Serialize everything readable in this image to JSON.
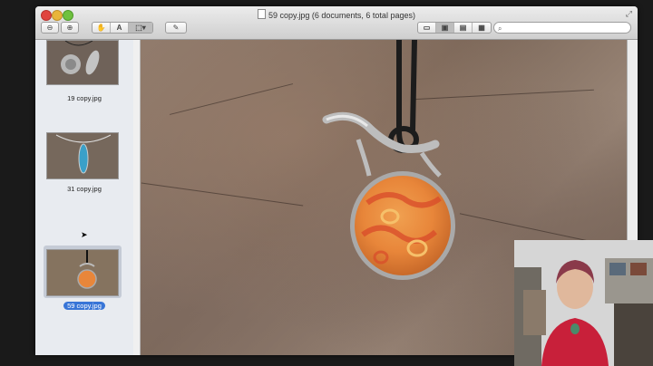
{
  "window": {
    "title": "59 copy.jpg (6 documents, 6 total pages)"
  },
  "toolbar": {
    "zoom_out_icon": "zoom-out-icon",
    "zoom_in_icon": "zoom-in-icon",
    "hand_tool_icon": "hand-icon",
    "text_tool_icon": "text-select-icon",
    "select_tool_icon": "rect-select-icon",
    "annotate_icon": "pencil-icon",
    "view_mode_icons": [
      "content-only-icon",
      "thumbnails-icon",
      "table-of-contents-icon",
      "contact-sheet-icon"
    ],
    "search_placeholder": ""
  },
  "sidebar": {
    "thumbnails": [
      {
        "label": "19 copy.jpg",
        "selected": false
      },
      {
        "label": "31 copy.jpg",
        "selected": false
      },
      {
        "label": "59 copy.jpg",
        "selected": true
      }
    ]
  },
  "colors": {
    "selection_blue": "#3875d7",
    "pendant_orange": "#e8863a",
    "stone_brown": "#8e7a6c"
  }
}
